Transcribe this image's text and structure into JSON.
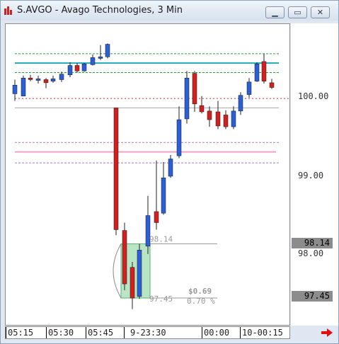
{
  "window": {
    "title": "S.AVGO - Avago Technologies, 3 Min",
    "minimize_icon": "minimize-icon",
    "restore_icon": "restore-icon",
    "close_icon": "close-icon"
  },
  "price_axis": {
    "labels": [
      "100.00",
      "99.00",
      "98.00"
    ],
    "tags": [
      "98.14",
      "97.45"
    ]
  },
  "time_axis": {
    "labels": [
      "05:15",
      "05:30",
      "05:45",
      "9-23:30",
      "00:00",
      "10-00:15"
    ]
  },
  "annotations": {
    "top_price": "98.14",
    "bottom_price": "97.45",
    "change_amount": "$0.69",
    "change_percent": "0.70 %"
  },
  "colors": {
    "up": "#2a5fd6",
    "down": "#d21f1f",
    "teal_line": "#1faab4",
    "green_dash": "#2e9e3a",
    "red_dotted": "#d03030",
    "pink": "#f0a0c8",
    "purple_dash": "#b07ad8",
    "highlight": "#7fcf96"
  },
  "chart_data": {
    "type": "candlestick",
    "title": "S.AVGO - Avago Technologies, 3 Min",
    "ylim": [
      97.25,
      100.75
    ],
    "candles": [
      {
        "open": 100.05,
        "high": 100.23,
        "low": 99.96,
        "close": 100.16
      },
      {
        "open": 100.02,
        "high": 100.28,
        "low": 100.02,
        "close": 100.25
      },
      {
        "open": 100.25,
        "high": 100.29,
        "low": 100.21,
        "close": 100.23
      },
      {
        "open": 100.22,
        "high": 100.28,
        "low": 100.18,
        "close": 100.24
      },
      {
        "open": 100.23,
        "high": 100.25,
        "low": 100.12,
        "close": 100.19
      },
      {
        "open": 100.21,
        "high": 100.28,
        "low": 100.19,
        "close": 100.24
      },
      {
        "open": 100.23,
        "high": 100.33,
        "low": 100.2,
        "close": 100.3
      },
      {
        "open": 100.29,
        "high": 100.45,
        "low": 100.26,
        "close": 100.41
      },
      {
        "open": 100.41,
        "high": 100.44,
        "low": 100.32,
        "close": 100.34
      },
      {
        "open": 100.34,
        "high": 100.44,
        "low": 100.33,
        "close": 100.43
      },
      {
        "open": 100.42,
        "high": 100.55,
        "low": 100.41,
        "close": 100.51
      },
      {
        "open": 100.5,
        "high": 100.67,
        "low": 100.48,
        "close": 100.52
      },
      {
        "open": 100.52,
        "high": 100.69,
        "low": 100.5,
        "close": 100.68
      },
      {
        "open": 99.87,
        "high": 99.87,
        "low": 98.25,
        "close": 98.32
      },
      {
        "open": 98.31,
        "high": 98.41,
        "low": 97.55,
        "close": 97.63
      },
      {
        "open": 97.84,
        "high": 97.91,
        "low": 97.31,
        "close": 97.45
      },
      {
        "open": 97.47,
        "high": 98.14,
        "low": 97.44,
        "close": 98.06
      },
      {
        "open": 98.11,
        "high": 98.75,
        "low": 98.01,
        "close": 98.5
      },
      {
        "open": 98.55,
        "high": 99.2,
        "low": 98.32,
        "close": 98.41
      },
      {
        "open": 98.53,
        "high": 99.18,
        "low": 98.51,
        "close": 98.98
      },
      {
        "open": 99.0,
        "high": 99.27,
        "low": 98.98,
        "close": 99.22
      },
      {
        "open": 99.26,
        "high": 99.89,
        "low": 99.23,
        "close": 99.72
      },
      {
        "open": 99.73,
        "high": 100.34,
        "low": 99.67,
        "close": 100.25
      },
      {
        "open": 100.31,
        "high": 100.34,
        "low": 99.82,
        "close": 99.92
      },
      {
        "open": 99.9,
        "high": 100.02,
        "low": 99.8,
        "close": 99.82
      },
      {
        "open": 99.83,
        "high": 99.89,
        "low": 99.63,
        "close": 99.72
      },
      {
        "open": 99.82,
        "high": 99.96,
        "low": 99.6,
        "close": 99.64
      },
      {
        "open": 99.78,
        "high": 99.84,
        "low": 99.6,
        "close": 99.63
      },
      {
        "open": 99.63,
        "high": 99.89,
        "low": 99.6,
        "close": 99.83
      },
      {
        "open": 99.83,
        "high": 100.07,
        "low": 99.78,
        "close": 100.03
      },
      {
        "open": 100.04,
        "high": 100.25,
        "low": 100.0,
        "close": 100.2
      },
      {
        "open": 100.21,
        "high": 100.45,
        "low": 100.2,
        "close": 100.43
      },
      {
        "open": 100.46,
        "high": 100.56,
        "low": 100.18,
        "close": 100.21
      },
      {
        "open": 100.19,
        "high": 100.24,
        "low": 100.11,
        "close": 100.13
      }
    ],
    "levels": [
      {
        "name": "green-upper",
        "value": 100.56
      },
      {
        "name": "teal",
        "value": 100.44
      },
      {
        "name": "green-lower",
        "value": 100.32
      },
      {
        "name": "red-dotted",
        "value": 99.99
      },
      {
        "name": "gray",
        "value": 99.87
      },
      {
        "name": "purple-upper",
        "value": 99.43
      },
      {
        "name": "pink",
        "value": 99.31
      },
      {
        "name": "purple-lower",
        "value": 99.17
      }
    ],
    "measure": {
      "high": 98.14,
      "low": 97.45,
      "change": 0.69,
      "percent": 0.7
    }
  }
}
